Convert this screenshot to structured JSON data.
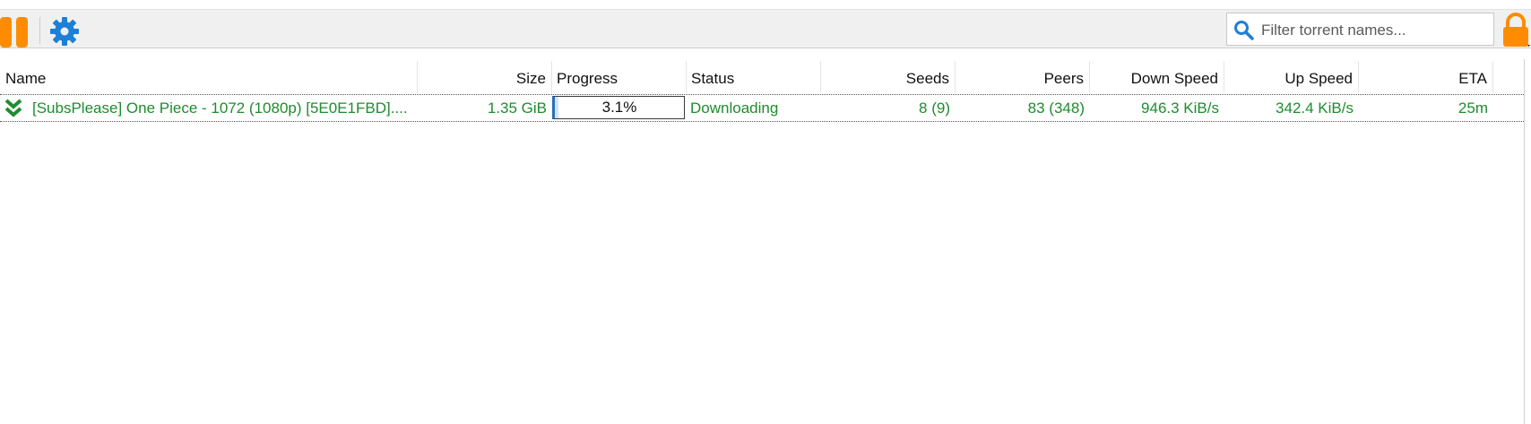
{
  "toolbar": {
    "pause_icon": "pause-icon",
    "settings_icon": "gear-icon",
    "search": {
      "placeholder": "Filter torrent names...",
      "value": ""
    },
    "lock_icon": "lock-icon",
    "accent_color": "#ff8c00",
    "settings_color": "#1e7fd6"
  },
  "table": {
    "columns": [
      "Name",
      "Size",
      "Progress",
      "Status",
      "Seeds",
      "Peers",
      "Down Speed",
      "Up Speed",
      "ETA"
    ],
    "rows": [
      {
        "icon": "download-chevron-icon",
        "name": "[SubsPlease] One Piece - 1072 (1080p) [5E0E1FBD]....",
        "size": "1.35 GiB",
        "progress_text": "3.1%",
        "progress_fraction": 0.031,
        "status": "Downloading",
        "seeds": "8 (9)",
        "peers": "83 (348)",
        "down_speed": "946.3 KiB/s",
        "up_speed": "342.4 KiB/s",
        "eta": "25m"
      }
    ],
    "row_text_color": "#1e8c2e"
  }
}
